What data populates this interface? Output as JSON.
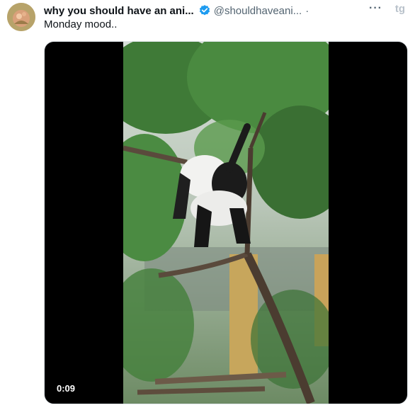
{
  "tweet": {
    "display_name": "why you should have an ani...",
    "handle": "@shouldhaveani...",
    "separator": "·",
    "more_label": "···",
    "brand_mark": "tg",
    "text": "Monday mood..",
    "verified": true
  },
  "video": {
    "duration": "0:09"
  },
  "colors": {
    "verified_badge": "#1d9bf0",
    "handle_gray": "#536471",
    "text": "#0f1419"
  },
  "icons": {
    "verified": "verified-badge-icon",
    "more": "more-options-icon"
  }
}
